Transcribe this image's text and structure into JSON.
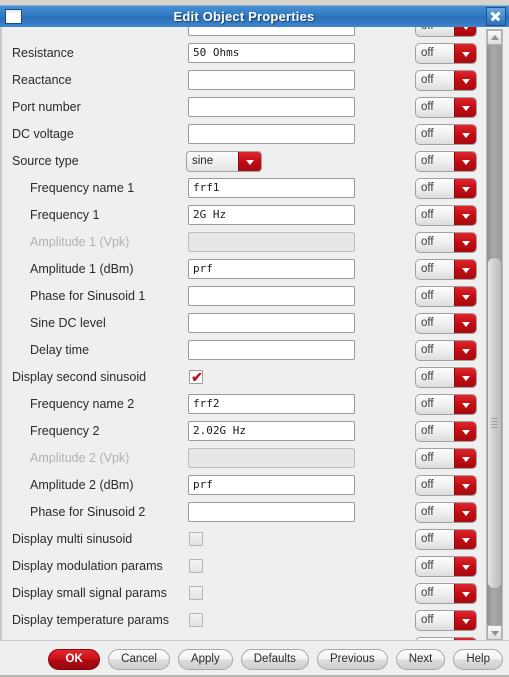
{
  "window": {
    "title": "Edit Object Properties",
    "icon": "window-icon",
    "close_icon": "close-icon"
  },
  "form": {
    "rows": [
      {
        "label": "",
        "indent": false,
        "disabled": false,
        "control": "text",
        "value": "",
        "toggle": "off",
        "clipped_top": true
      },
      {
        "label": "Resistance",
        "indent": false,
        "disabled": false,
        "control": "text",
        "value": "50 Ohms",
        "toggle": "off"
      },
      {
        "label": "Reactance",
        "indent": false,
        "disabled": false,
        "control": "text",
        "value": "",
        "toggle": "off"
      },
      {
        "label": "Port number",
        "indent": false,
        "disabled": false,
        "control": "text",
        "value": "",
        "toggle": "off"
      },
      {
        "label": "DC voltage",
        "indent": false,
        "disabled": false,
        "control": "text",
        "value": "",
        "toggle": "off"
      },
      {
        "label": "Source type",
        "indent": false,
        "disabled": false,
        "control": "select",
        "value": "sine",
        "toggle": "off"
      },
      {
        "label": "Frequency name 1",
        "indent": true,
        "disabled": false,
        "control": "text",
        "value": "frf1",
        "toggle": "off"
      },
      {
        "label": "Frequency 1",
        "indent": true,
        "disabled": false,
        "control": "text",
        "value": "2G Hz",
        "toggle": "off"
      },
      {
        "label": "Amplitude 1 (Vpk)",
        "indent": true,
        "disabled": true,
        "control": "text",
        "value": "",
        "toggle": "off"
      },
      {
        "label": "Amplitude 1 (dBm)",
        "indent": true,
        "disabled": false,
        "control": "text",
        "value": "prf",
        "toggle": "off"
      },
      {
        "label": "Phase for Sinusoid 1",
        "indent": true,
        "disabled": false,
        "control": "text",
        "value": "",
        "toggle": "off"
      },
      {
        "label": "Sine DC level",
        "indent": true,
        "disabled": false,
        "control": "text",
        "value": "",
        "toggle": "off"
      },
      {
        "label": "Delay time",
        "indent": true,
        "disabled": false,
        "control": "text",
        "value": "",
        "toggle": "off"
      },
      {
        "label": "Display second sinusoid",
        "indent": false,
        "disabled": false,
        "control": "checkbox",
        "checked": true,
        "toggle": "off"
      },
      {
        "label": "Frequency name 2",
        "indent": true,
        "disabled": false,
        "control": "text",
        "value": "frf2",
        "toggle": "off"
      },
      {
        "label": "Frequency 2",
        "indent": true,
        "disabled": false,
        "control": "text",
        "value": "2.02G Hz",
        "toggle": "off"
      },
      {
        "label": "Amplitude 2 (Vpk)",
        "indent": true,
        "disabled": true,
        "control": "text",
        "value": "",
        "toggle": "off"
      },
      {
        "label": "Amplitude 2 (dBm)",
        "indent": true,
        "disabled": false,
        "control": "text",
        "value": "prf",
        "toggle": "off"
      },
      {
        "label": "Phase for Sinusoid 2",
        "indent": true,
        "disabled": false,
        "control": "text",
        "value": "",
        "toggle": "off"
      },
      {
        "label": "Display multi sinusoid",
        "indent": false,
        "disabled": false,
        "control": "checkbox",
        "checked": false,
        "toggle": "off"
      },
      {
        "label": "Display modulation params",
        "indent": false,
        "disabled": false,
        "control": "checkbox",
        "checked": false,
        "toggle": "off"
      },
      {
        "label": "Display small signal params",
        "indent": false,
        "disabled": false,
        "control": "checkbox",
        "checked": false,
        "toggle": "off"
      },
      {
        "label": "Display temperature params",
        "indent": false,
        "disabled": false,
        "control": "checkbox",
        "checked": false,
        "toggle": "off"
      },
      {
        "label": "",
        "indent": false,
        "disabled": false,
        "control": "checkbox",
        "checked": false,
        "toggle": "off",
        "clipped_bottom": true
      }
    ]
  },
  "scrollbar": {
    "up_icon": "scroll-up-arrow-icon",
    "down_icon": "scroll-down-arrow-icon"
  },
  "buttons": [
    {
      "label": "OK",
      "primary": true
    },
    {
      "label": "Cancel",
      "primary": false
    },
    {
      "label": "Apply",
      "primary": false
    },
    {
      "label": "Defaults",
      "primary": false
    },
    {
      "label": "Previous",
      "primary": false
    },
    {
      "label": "Next",
      "primary": false
    },
    {
      "label": "Help",
      "primary": false
    }
  ],
  "colors": {
    "titlebar": "#2f7ac4",
    "accent_red": "#c00d14",
    "background": "#efefef"
  }
}
